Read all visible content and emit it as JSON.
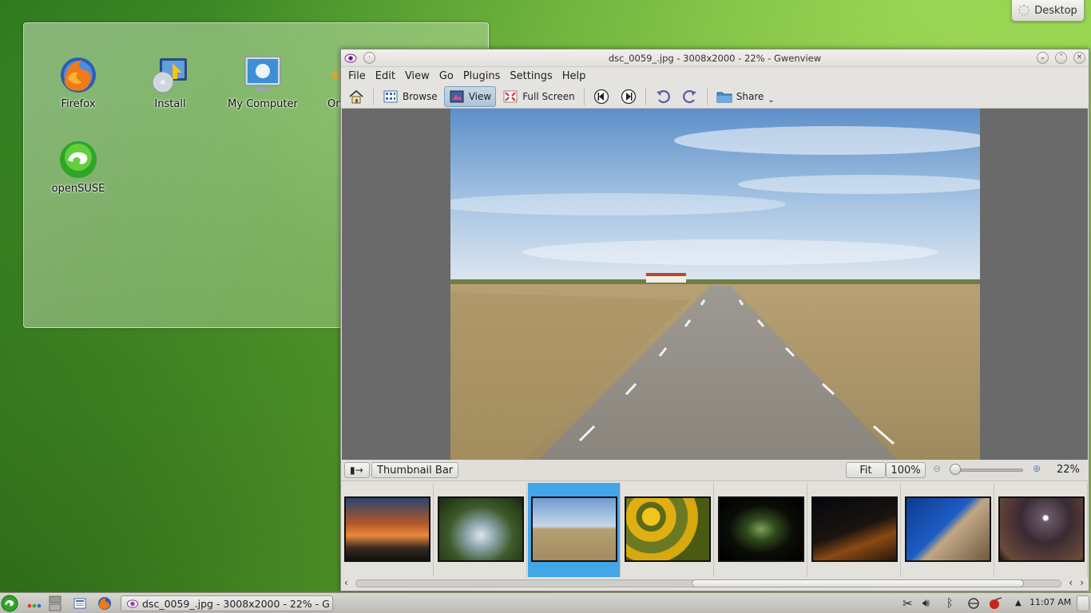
{
  "desktop": {
    "toolbox_label": "Desktop",
    "icons": [
      {
        "label": "Firefox",
        "icon": "firefox-icon"
      },
      {
        "label": "Install",
        "icon": "install-icon"
      },
      {
        "label": "My Computer",
        "icon": "computer-icon"
      },
      {
        "label": "On",
        "icon": "online-help-icon"
      },
      {
        "label": "openSUSE",
        "icon": "opensuse-icon"
      }
    ]
  },
  "window": {
    "title": "dsc_0059_.jpg - 3008x2000 - 22% - Gwenview",
    "menu": [
      "File",
      "Edit",
      "View",
      "Go",
      "Plugins",
      "Settings",
      "Help"
    ],
    "toolbar": {
      "browse_label": "Browse",
      "view_label": "View",
      "fullscreen_label": "Full Screen",
      "share_label": "Share"
    },
    "statusbar": {
      "thumbnail_bar_label": "Thumbnail Bar",
      "fit_label": "Fit",
      "zoom100_label": "100%",
      "zoom_value": "22%",
      "zoom_level": 0.22
    },
    "thumbnails": [
      {
        "name": "sunset",
        "selected": false
      },
      {
        "name": "waterfall",
        "selected": false
      },
      {
        "name": "road",
        "selected": true
      },
      {
        "name": "yellow-flowers",
        "selected": false
      },
      {
        "name": "leaves-night",
        "selected": false
      },
      {
        "name": "night-road",
        "selected": false
      },
      {
        "name": "blue-sky-building",
        "selected": false
      },
      {
        "name": "moon-sky",
        "selected": false
      }
    ]
  },
  "taskbar": {
    "task_label": "dsc_0059_.jpg - 3008x2000 - 22% - G",
    "clock": "11:07 AM"
  },
  "colors": {
    "selection": "#42a6e8",
    "desktop_green": "#5fa52f"
  }
}
